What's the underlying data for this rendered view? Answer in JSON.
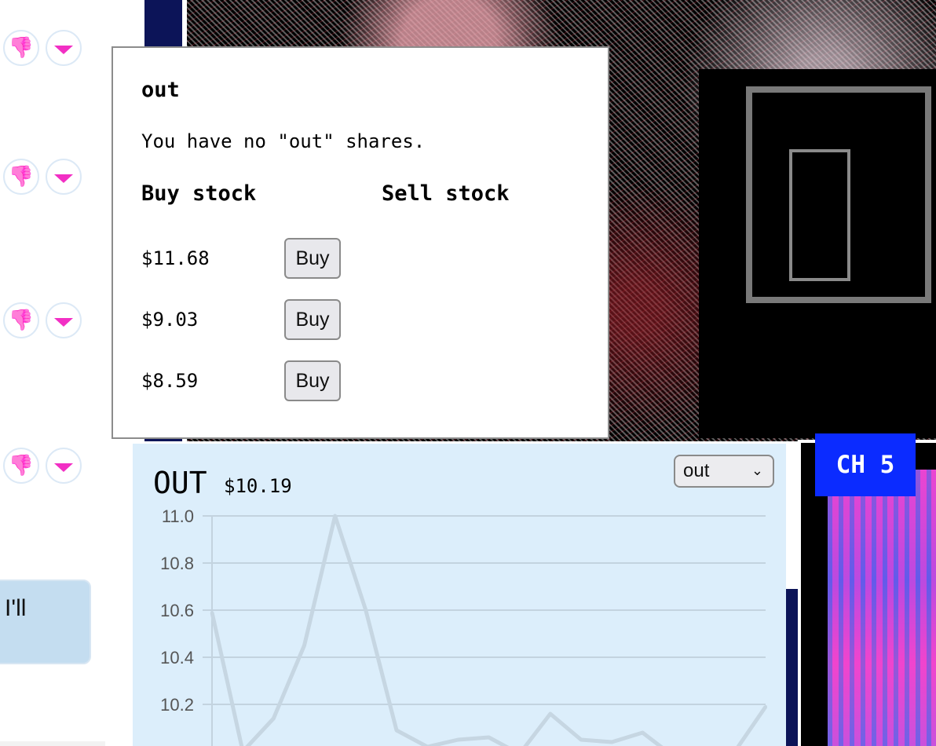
{
  "vote_rows": [
    {
      "down_icon": "thumbs-down-icon",
      "arrow_icon": "triangle-down-icon"
    },
    {
      "down_icon": "thumbs-down-icon",
      "arrow_icon": "triangle-down-icon"
    },
    {
      "down_icon": "thumbs-down-icon",
      "arrow_icon": "triangle-down-icon"
    },
    {
      "down_icon": "thumbs-down-icon",
      "arrow_icon": "triangle-down-icon"
    }
  ],
  "chat": {
    "partial_text": "I'll"
  },
  "popover": {
    "title": "out",
    "message": "You have no \"out\" shares.",
    "buy_heading": "Buy stock",
    "sell_heading": "Sell stock",
    "offers": [
      {
        "price": "$11.68",
        "button": "Buy"
      },
      {
        "price": "$9.03",
        "button": "Buy"
      },
      {
        "price": "$8.59",
        "button": "Buy"
      }
    ]
  },
  "channel": {
    "label": "CH 5"
  },
  "stock_panel": {
    "ticker": "OUT",
    "price": "$10.19",
    "selected_stock": "out"
  },
  "colors": {
    "accent_blue": "#0b2bff",
    "panel_bg": "#dceefb",
    "vote_pink": "#f22fc4",
    "dark_navy": "#0c1458"
  },
  "chart_data": {
    "type": "line",
    "title": "",
    "xlabel": "",
    "ylabel": "",
    "y_ticks": [
      "11.0",
      "10.8",
      "10.6",
      "10.4",
      "10.2"
    ],
    "ylim": [
      10.0,
      11.0
    ],
    "grid": true,
    "series": [
      {
        "values": [
          10.59,
          10.0,
          10.14,
          10.45,
          11.0,
          10.6,
          10.09,
          10.02,
          10.05,
          10.06,
          9.99,
          10.16,
          10.05,
          10.04,
          10.08,
          9.98,
          9.97,
          10.0,
          10.19
        ]
      }
    ]
  }
}
